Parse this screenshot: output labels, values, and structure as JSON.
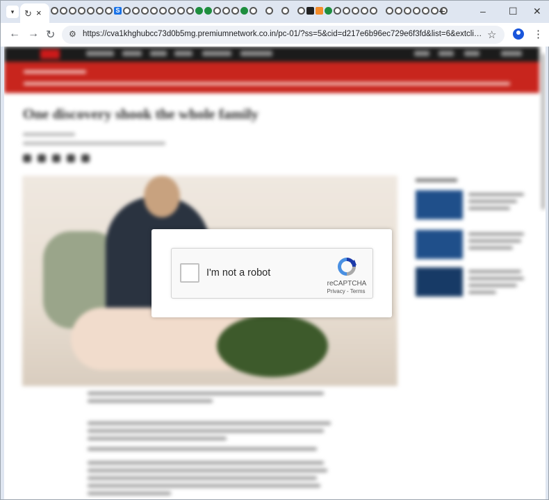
{
  "browser": {
    "tab_close_icon": "×",
    "new_tab_icon": "+",
    "minimize_icon": "–",
    "maximize_icon": "☐",
    "close_window_icon": "✕",
    "back_icon": "←",
    "forward_icon": "→",
    "reload_icon": "↻",
    "site_info_icon": "⚙",
    "bookmark_icon": "☆",
    "menu_icon": "⋮",
    "url": "https://cva1khghubcc73d0b5mg.premiumnetwork.co.in/pc-01/?ss=5&cid=d217e6b96ec729e6f3fd&list=6&extclickid=88901..."
  },
  "page": {
    "headline": "One discovery shook the whole family"
  },
  "captcha": {
    "checkbox_label": "I'm not a robot",
    "brand": "reCAPTCHA",
    "privacy_link": "Privacy",
    "separator": " - ",
    "terms_link": "Terms"
  }
}
